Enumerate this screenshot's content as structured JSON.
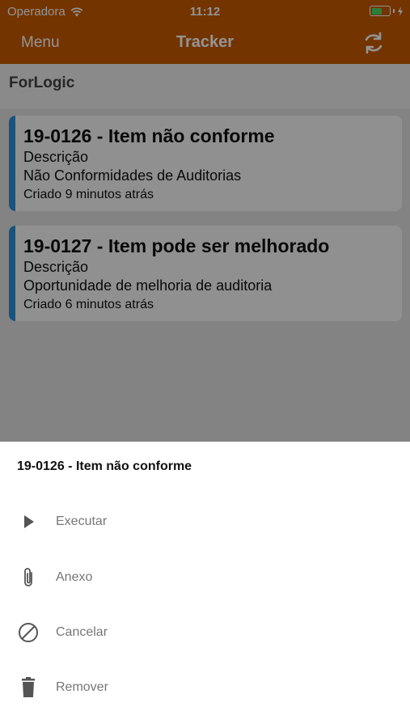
{
  "status_bar": {
    "carrier": "Operadora",
    "time": "11:12"
  },
  "nav": {
    "menu_label": "Menu",
    "title": "Tracker",
    "sync_icon": "sync-icon"
  },
  "section": {
    "header": "ForLogic"
  },
  "cards": [
    {
      "title": "19-0126 - Item não conforme",
      "label": "Descrição",
      "type": "Não Conformidades de Auditorias",
      "created": "Criado 9 minutos atrás"
    },
    {
      "title": "19-0127 - Item pode ser melhorado",
      "label": "Descrição",
      "type": "Oportunidade de melhoria de auditoria",
      "created": "Criado 6 minutos atrás"
    }
  ],
  "sheet": {
    "title": "19-0126 - Item não conforme",
    "actions": [
      {
        "label": "Executar",
        "icon": "play-icon"
      },
      {
        "label": "Anexo",
        "icon": "paperclip-icon"
      },
      {
        "label": "Cancelar",
        "icon": "cancel-icon"
      },
      {
        "label": "Remover",
        "icon": "trash-icon"
      }
    ]
  },
  "colors": {
    "brand": "#c75a00",
    "accent": "#2e8fd4",
    "battery": "#4cd964"
  }
}
